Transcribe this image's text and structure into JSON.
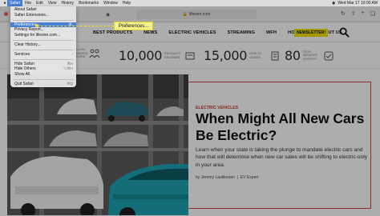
{
  "menubar": {
    "items": [
      "Safari",
      "File",
      "Edit",
      "View",
      "History",
      "Bookmarks",
      "Window",
      "Help"
    ],
    "active_index": 0,
    "clock": "Wed Mar 17 10:00 AM"
  },
  "toolbar": {
    "url": "lifewire.com"
  },
  "safari_menu": {
    "items": [
      {
        "label": "About Safari",
        "shortcut": ""
      },
      {
        "label": "Safari Extensions...",
        "shortcut": ""
      },
      {
        "sep": true
      },
      {
        "label": "Preferences...",
        "shortcut": "⌘,",
        "highlight": true
      },
      {
        "label": "Privacy Report...",
        "shortcut": ""
      },
      {
        "label": "Settings for lifewire.com...",
        "shortcut": ""
      },
      {
        "sep": true
      },
      {
        "label": "Clear History...",
        "shortcut": ""
      },
      {
        "sep": true
      },
      {
        "label": "Services",
        "shortcut": "›"
      },
      {
        "sep": true
      },
      {
        "label": "Hide Safari",
        "shortcut": "⌘H"
      },
      {
        "label": "Hide Others",
        "shortcut": "⌥⌘H"
      },
      {
        "label": "Show All",
        "shortcut": ""
      },
      {
        "sep": true
      },
      {
        "label": "Quit Safari",
        "shortcut": "⌘Q"
      }
    ]
  },
  "callout": {
    "label": "Preferences..."
  },
  "site": {
    "nav": [
      "BEST PRODUCTS",
      "NEWS",
      "ELECTRIC VEHICLES",
      "STREAMING",
      "WFH",
      "HOW-TO",
      "ABOUT US"
    ],
    "newsletter_label": "NEWSLETTER!",
    "stats": [
      {
        "pre": "BILLION READERS HELPED",
        "num": "",
        "label": ""
      },
      {
        "num": "10,000",
        "label": "PRODUCTS REVIEWED"
      },
      {
        "num": "15,000",
        "label": "HOW-TO GUIDES"
      },
      {
        "num": "80",
        "label": "TECH INDUSTRY EXPERTS"
      }
    ]
  },
  "article": {
    "category": "ELECTRIC VEHICLES",
    "headline": "When Might All New Cars Be Electric?",
    "dek": "Learn when your state is taking the plunge to mandate electric cars and how that will determine when new car sales will be shifting to electric-only in your area.",
    "byline": "by Jeremy Laukkonen",
    "byline_role": "EV Expert"
  },
  "colors": {
    "accent_red": "#c0392b",
    "newsletter_yellow": "#f2e200",
    "menu_highlight": "#4a7fd6"
  }
}
